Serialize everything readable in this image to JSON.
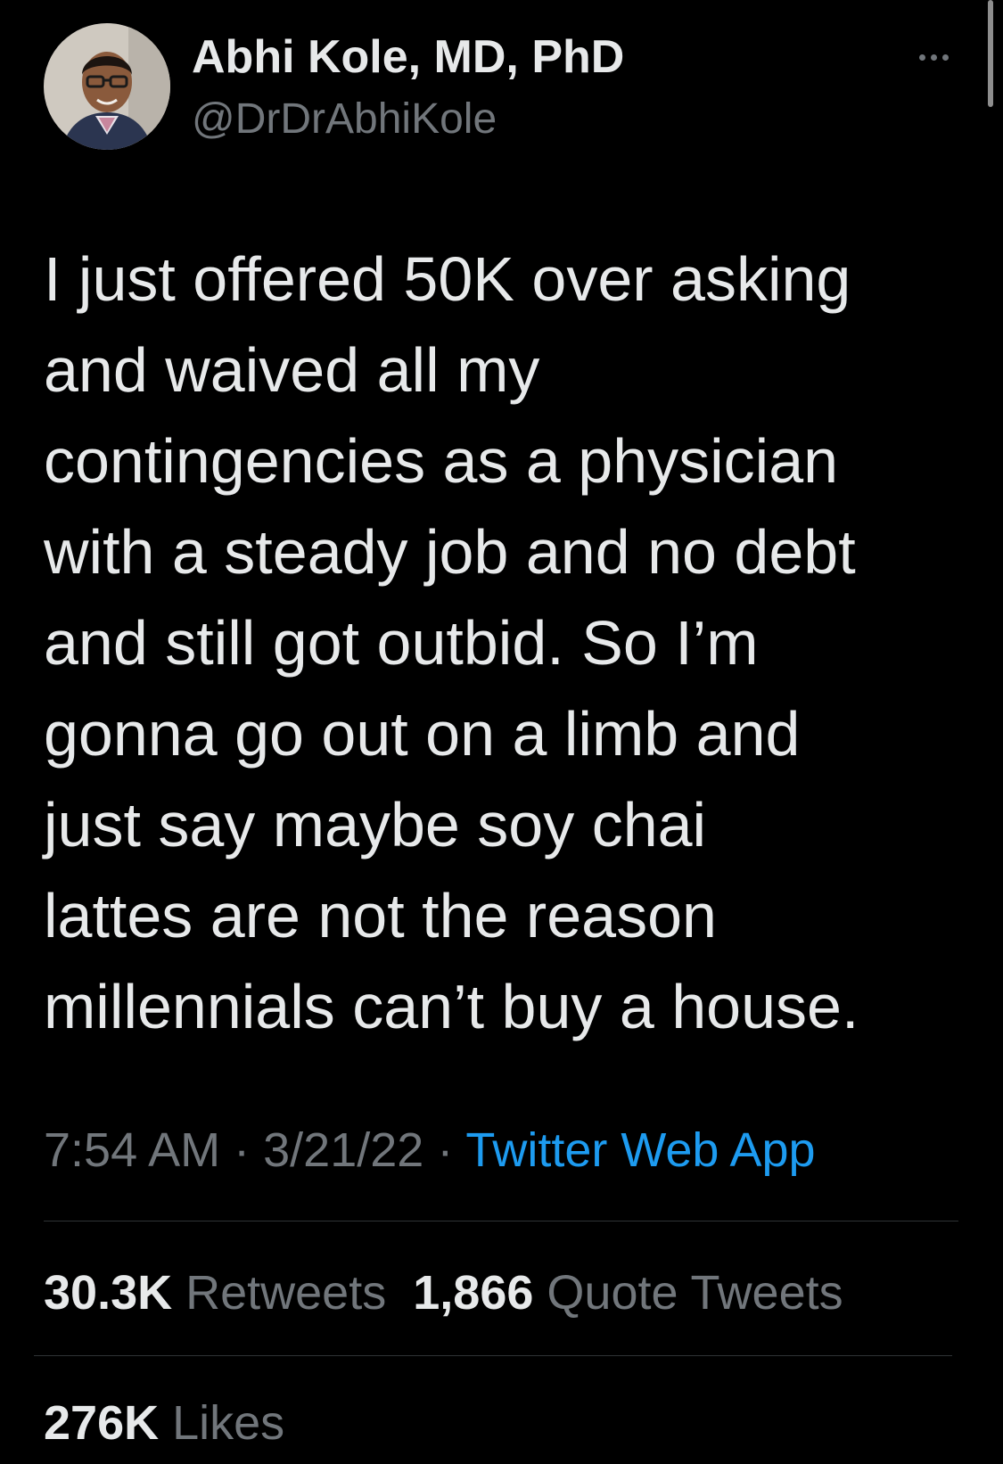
{
  "author": {
    "display_name": "Abhi Kole, MD, PhD",
    "handle": "@DrDrAbhiKole",
    "avatar_icon": "profile-photo"
  },
  "tweet": {
    "lines": [
      "I just offered 50K over asking",
      "and waived all my",
      "contingencies as a physician",
      "with a steady job and no debt",
      "and still got outbid. So I’m",
      "gonna go out on a limb and",
      "just say maybe soy chai",
      "lattes are not the reason",
      "millennials can’t buy a house."
    ],
    "time": "7:54 AM",
    "date": "3/21/22",
    "separator": "·",
    "source": "Twitter Web App"
  },
  "stats": {
    "retweets_count": "30.3K",
    "retweets_label": "Retweets",
    "quotes_count": "1,866",
    "quotes_label": "Quote Tweets",
    "likes_count": "276K",
    "likes_label": "Likes"
  },
  "colors": {
    "background": "#000000",
    "text_primary": "#e7e9ea",
    "text_secondary": "#71767b",
    "link": "#1d9bf0",
    "divider": "#2f3336"
  }
}
